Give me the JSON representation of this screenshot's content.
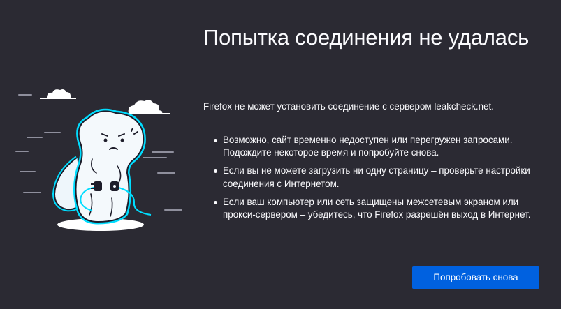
{
  "error_page": {
    "title": "Попытка соединения не удалась",
    "short_description": "Firefox не может установить соединение с сервером leakcheck.net.",
    "tips": [
      {
        "text": "Возможно, сайт временно недоступен или перегружен запросами. Подождите некоторое время и попробуйте снова."
      },
      {
        "text": "Если вы не можете загрузить ни одну страницу – проверьте настройки соединения с Интернетом."
      },
      {
        "text": "Если ваш компьютер или сеть защищены межсетевым экраном или прокси-сервером – убедитесь, что Firefox разрешён выход в Интернет."
      }
    ],
    "retry_button_label": "Попробовать снова",
    "illustration_icon": "dino-unplugged-icon"
  },
  "colors": {
    "background": "#2b2a33",
    "text": "#fbfbfe",
    "button": "#0061e0",
    "dino_outline": "#00ddff"
  }
}
